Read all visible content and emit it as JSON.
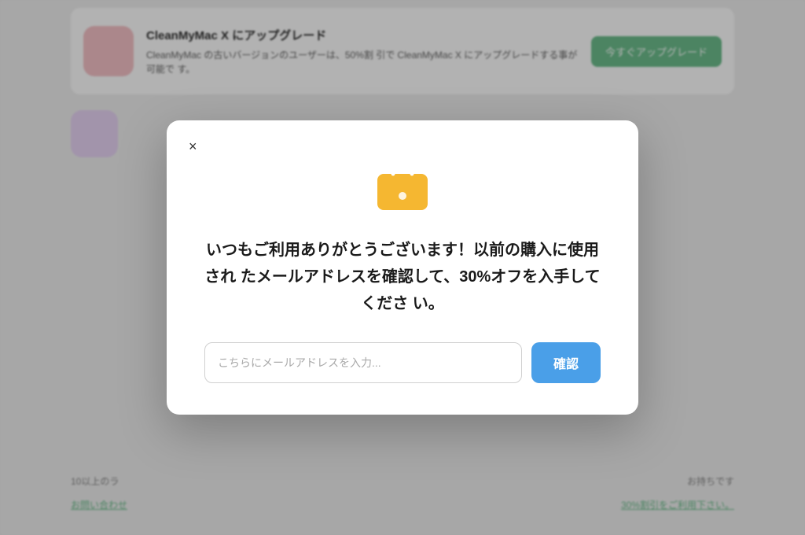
{
  "background": {
    "card_top": {
      "title": "CleanMyMac X にアップグレード",
      "body": "CleanMyMac の古いバージョンのユーザーは、50%割\n引で CleanMyMac X にアップグレードする事が可能で\nす。",
      "button_label": "今すぐアップグレード"
    },
    "bottom_left": "10以上のラ",
    "bottom_right": "お持ちです",
    "link_left": "お問い合わせ",
    "link_right": "30%割引をご利用下さい。"
  },
  "modal": {
    "close_label": "×",
    "icon_alt": "shopping-bag",
    "title": "いつもご利用ありがとうございます！以前の購入に使用され\nたメールアドレスを確認して、30%オフを入手してくださ\nい。",
    "email_placeholder": "こちらにメールアドレスを入力...",
    "confirm_button_label": "確認"
  },
  "colors": {
    "confirm_button_bg": "#4a9fe8",
    "upgrade_button_bg": "#6dbe8d",
    "bag_body": "#f5b731",
    "bag_handle": "#ffffff",
    "bag_dot": "#ffffff"
  }
}
